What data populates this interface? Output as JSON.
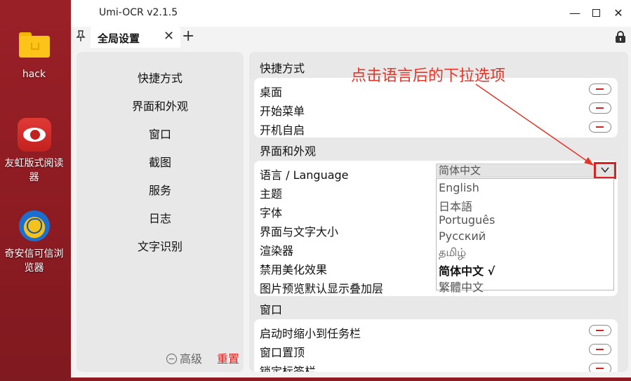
{
  "desktop": {
    "icons": [
      {
        "label": "hack",
        "icon": "folder-icon"
      },
      {
        "label": "友虹版式阅读器",
        "icon": "ofd-reader-icon"
      },
      {
        "label": "奇安信可信浏览器",
        "icon": "browser-icon"
      }
    ]
  },
  "window": {
    "title": "Umi-OCR v2.1.5",
    "controls": {
      "minimize": "—",
      "close": "✕"
    }
  },
  "tabbar": {
    "pin": "📌",
    "tab_label": "全局设置",
    "tab_close": "✕",
    "add": "+"
  },
  "nav": {
    "items": [
      "快捷方式",
      "界面和外观",
      "窗口",
      "截图",
      "服务",
      "日志",
      "文字识别"
    ],
    "advanced_label": "高级",
    "reset_label": "重置"
  },
  "sections": {
    "shortcuts": {
      "title": "快捷方式",
      "rows": [
        "桌面",
        "开始菜单",
        "开机自启"
      ]
    },
    "ui": {
      "title": "界面和外观",
      "rows": [
        "语言 / Language",
        "主题",
        "字体",
        "界面与文字大小",
        "渲染器",
        "禁用美化效果",
        "图片预览默认显示叠加层"
      ],
      "language_value": "简体中文",
      "language_options": [
        {
          "label": "English",
          "selected": false
        },
        {
          "label": "日本語",
          "selected": false
        },
        {
          "label": "Português",
          "selected": false
        },
        {
          "label": "Русский",
          "selected": false
        },
        {
          "label": "தமிழ்",
          "selected": false
        },
        {
          "label": "简体中文 √",
          "selected": true
        },
        {
          "label": "繁體中文",
          "selected": false
        }
      ]
    },
    "window": {
      "title": "窗口",
      "rows": [
        "启动时缩小到任务栏",
        "窗口置顶",
        "锁定标签栏"
      ]
    }
  },
  "annotation": {
    "text": "点击语言后的下拉选项",
    "color": "#e53529"
  },
  "colors": {
    "accent_red": "#d9201e",
    "panel": "#e8e8e8",
    "card": "#ffffff"
  }
}
